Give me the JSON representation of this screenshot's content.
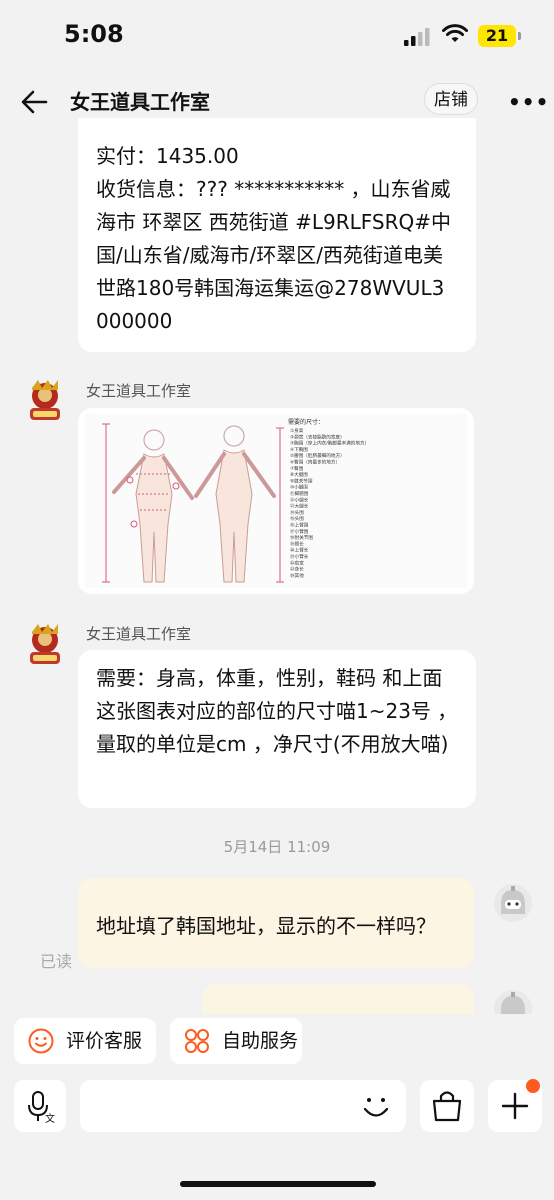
{
  "status_bar": {
    "time": "5:08",
    "battery": "21"
  },
  "header": {
    "title": "女王道具工作室",
    "shop_button": "店铺",
    "more_icon": "more-dots-icon"
  },
  "messages": {
    "order": {
      "paid_line": "实付：1435.00",
      "address_line": "收货信息：??? *********** ，山东省威海市 环翠区 西苑街道 #L9RLFSRQ#中国/山东省/威海市/环翠区/西苑街道电美世路180号韩国海运集运@278WVUL3 000000"
    },
    "image_message": {
      "sender": "女王道具工作室",
      "chart_title": "需要的尺寸：",
      "size_list": [
        "①身高",
        "②颈宽（去掉脂肪的宽度）",
        "③胸围（穿上内衣/胸部最丰满的地方）",
        "④下胸围",
        "⑤腰围（肚脐最细的地方）",
        "⑥臀围（肉最多的地方）",
        "⑦臀围",
        "⑧大腿围",
        "⑨膝关节围",
        "⑩小腿围",
        "⑪脚腕围",
        "⑫小腿长",
        "⑬大腿长",
        "⑭头围",
        "⑮头围",
        "⑯上臂围",
        "⑰小臂围",
        "⑱肘关节围",
        "⑲臂长",
        "⑳上臂长",
        "㉑小臂长",
        "㉒肩宽",
        "㉓身长",
        "㉔其他"
      ]
    },
    "text_message": {
      "sender": "女王道具工作室",
      "text": "需要：身高，体重，性别，鞋码 和上面这张图表对应的部位的尺寸喵1~23号 ，量取的单位是cm ，净尺寸(不用放大喵)"
    },
    "timestamp": "5月14日 11:09",
    "my_message": {
      "text": "地址填了韩国地址，显示的不一样吗？",
      "read_status": "已读"
    }
  },
  "quick_services": [
    {
      "label": "评价客服",
      "icon": "smile-rating-icon"
    },
    {
      "label": "自助服务",
      "icon": "self-service-icon"
    }
  ],
  "input_bar": {
    "placeholder": "",
    "voice_icon": "voice-input-icon",
    "emoji_icon": "emoji-icon",
    "bag_icon": "shopping-bag-icon",
    "plus_icon": "plus-icon"
  },
  "colors": {
    "accent": "#ff5a1f",
    "my_bubble": "#fdf5e3",
    "background": "#f2f2f2"
  }
}
